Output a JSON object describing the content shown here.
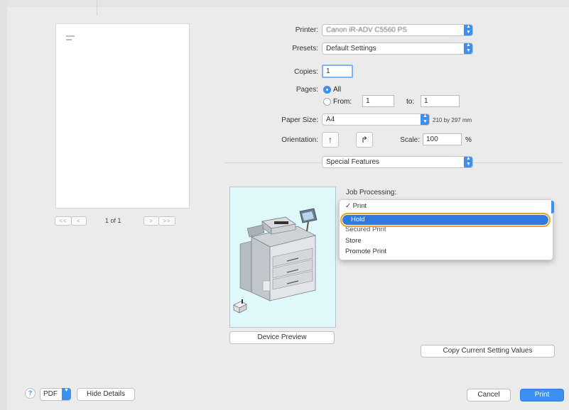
{
  "preview": {
    "page_indicator": "1 of 1",
    "first_label": "<<",
    "prev_label": "<",
    "next_label": ">",
    "last_label": ">>"
  },
  "printer": {
    "label": "Printer:",
    "value": "Canon iR-ADV C5560 PS"
  },
  "presets": {
    "label": "Presets:",
    "value": "Default Settings"
  },
  "copies": {
    "label": "Copies:",
    "value": "1"
  },
  "pages": {
    "label": "Pages:",
    "all_label": "All",
    "from_label": "From:",
    "from_value": "1",
    "to_label": "to:",
    "to_value": "1"
  },
  "paper_size": {
    "label": "Paper Size:",
    "value": "A4",
    "dimensions": "210 by 297 mm"
  },
  "orientation": {
    "label": "Orientation:",
    "portrait_glyph": "↑",
    "landscape_glyph": "↱"
  },
  "scale": {
    "label": "Scale:",
    "value": "100",
    "unit": "%"
  },
  "section_popup": {
    "value": "Special Features"
  },
  "device_preview_button": "Device Preview",
  "job_processing": {
    "label": "Job Processing:",
    "items": [
      {
        "label": "✓ Print"
      },
      {
        "label": "Hold"
      },
      {
        "label": "Secured Print"
      },
      {
        "label": "Store"
      },
      {
        "label": "Promote Print"
      }
    ],
    "selected": "Hold"
  },
  "copy_settings_button": "Copy Current Setting Values",
  "footer": {
    "help": "?",
    "pdf": "PDF",
    "hide_details": "Hide Details",
    "cancel": "Cancel",
    "print": "Print"
  },
  "colors": {
    "accent": "#3d8ff2",
    "highlight_ring": "#f0a020",
    "device_bg": "#dff8fc"
  },
  "icons": [
    "updown-chevron-icon",
    "portrait-icon",
    "landscape-icon",
    "printer-device-icon",
    "paper-stack-icon",
    "help-icon",
    "checkmark-icon"
  ]
}
